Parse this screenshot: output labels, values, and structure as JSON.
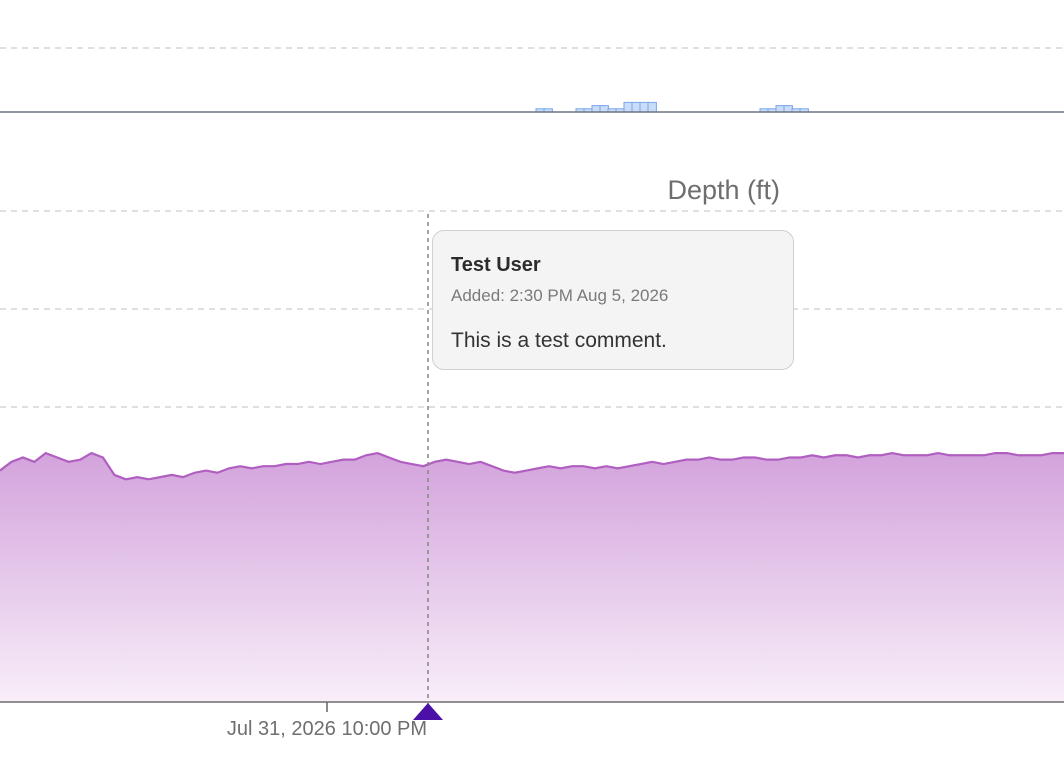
{
  "chart_data": [
    {
      "type": "bar",
      "title": "",
      "xlabel": "",
      "ylabel": "",
      "grid": true,
      "series": [
        {
          "color": "#8cb4f0",
          "values": [
            0,
            0,
            0,
            0,
            0,
            0,
            0,
            0,
            0,
            0,
            0,
            0,
            0,
            0,
            0,
            0,
            0,
            0,
            0,
            0,
            0,
            0,
            0,
            0,
            0,
            0,
            0,
            0,
            0,
            0,
            0,
            0,
            0,
            0,
            0,
            0,
            0,
            0,
            0,
            0,
            0,
            0,
            0,
            0,
            0,
            0,
            0,
            0,
            0,
            0,
            0,
            0,
            0,
            0,
            0,
            0,
            0,
            0,
            0,
            0,
            0,
            0,
            0,
            0,
            0,
            0,
            0,
            1,
            1,
            0,
            0,
            0,
            1,
            1,
            2,
            2,
            1,
            1,
            3,
            3,
            3,
            3,
            0,
            0,
            0,
            0,
            0,
            0,
            0,
            0,
            0,
            0,
            0,
            0,
            0,
            1,
            1,
            2,
            2,
            1,
            1,
            0,
            0,
            0,
            0,
            0,
            0,
            0,
            0,
            0,
            0,
            0,
            0,
            0,
            0,
            0,
            0,
            0,
            0,
            0,
            0,
            0,
            0,
            0,
            0,
            0,
            0,
            0,
            0,
            0,
            0,
            0,
            0
          ]
        }
      ]
    },
    {
      "type": "area",
      "title": "Depth (ft)",
      "xlabel": "",
      "ylabel": "",
      "grid": true,
      "x_tick_labels": [
        "Jul 31, 2026 10:00 PM"
      ],
      "marker_label": "Aug 5, 2026 2:30 PM",
      "series": [
        {
          "color": "#b05fc0",
          "fill": "#d7a8de",
          "values": [
            60.6,
            61.0,
            61.2,
            61.0,
            61.4,
            61.2,
            61.0,
            61.1,
            61.4,
            61.2,
            60.4,
            60.2,
            60.3,
            60.2,
            60.3,
            60.4,
            60.3,
            60.5,
            60.6,
            60.5,
            60.7,
            60.8,
            60.7,
            60.8,
            60.8,
            60.9,
            60.9,
            61.0,
            60.9,
            61.0,
            61.1,
            61.1,
            61.3,
            61.4,
            61.2,
            61.0,
            60.9,
            60.8,
            61.0,
            61.1,
            61.0,
            60.9,
            61.0,
            60.8,
            60.6,
            60.5,
            60.6,
            60.7,
            60.8,
            60.7,
            60.8,
            60.8,
            60.7,
            60.8,
            60.7,
            60.8,
            60.9,
            61.0,
            60.9,
            61.0,
            61.1,
            61.1,
            61.2,
            61.1,
            61.1,
            61.2,
            61.2,
            61.1,
            61.1,
            61.2,
            61.2,
            61.3,
            61.2,
            61.3,
            61.3,
            61.2,
            61.3,
            61.3,
            61.4,
            61.3,
            61.3,
            61.3,
            61.4,
            61.3,
            61.3,
            61.3,
            61.3,
            61.4,
            61.4,
            61.3,
            61.3,
            61.3,
            61.4,
            61.4
          ]
        }
      ]
    }
  ],
  "comment": {
    "author": "Test User",
    "added": "Added: 2:30 PM Aug 5, 2026",
    "body": "This is a test comment."
  }
}
